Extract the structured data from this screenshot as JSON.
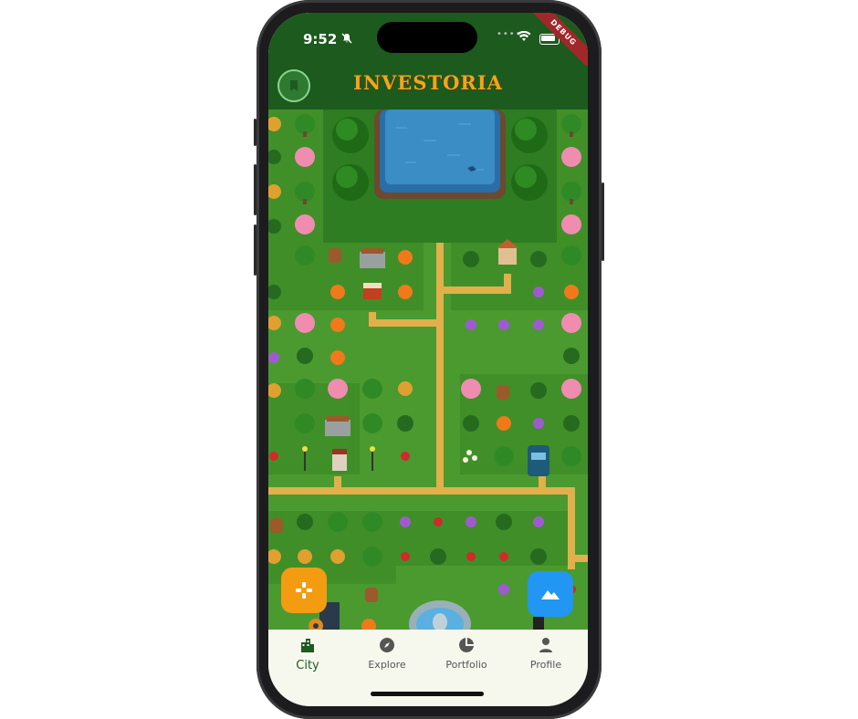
{
  "status_bar": {
    "time": "9:52",
    "debug_banner": "DEBUG",
    "icons": [
      "mute-icon",
      "signal-dots-icon",
      "wifi-icon",
      "battery-icon"
    ]
  },
  "app_bar": {
    "title": "INVESTORIA",
    "title_color": "#f0a51c",
    "background": "#1c5a1e",
    "bookmark_icon": "bookmark-icon"
  },
  "map": {
    "description_elements": [
      "pond",
      "trees",
      "bushes",
      "flowers",
      "paths",
      "benches",
      "market-stall",
      "house",
      "squirrels",
      "lamp-posts",
      "fountain",
      "bus-stop"
    ]
  },
  "fabs": {
    "game": {
      "icon": "gamepad-icon",
      "color": "#f39c12"
    },
    "landscape": {
      "icon": "mountain-icon",
      "color": "#2196f3"
    }
  },
  "nav": {
    "items": [
      {
        "label": "City",
        "icon": "city-icon",
        "active": true
      },
      {
        "label": "Explore",
        "icon": "compass-icon",
        "active": false
      },
      {
        "label": "Portfolio",
        "icon": "pie-chart-icon",
        "active": false
      },
      {
        "label": "Profile",
        "icon": "person-icon",
        "active": false
      }
    ]
  }
}
